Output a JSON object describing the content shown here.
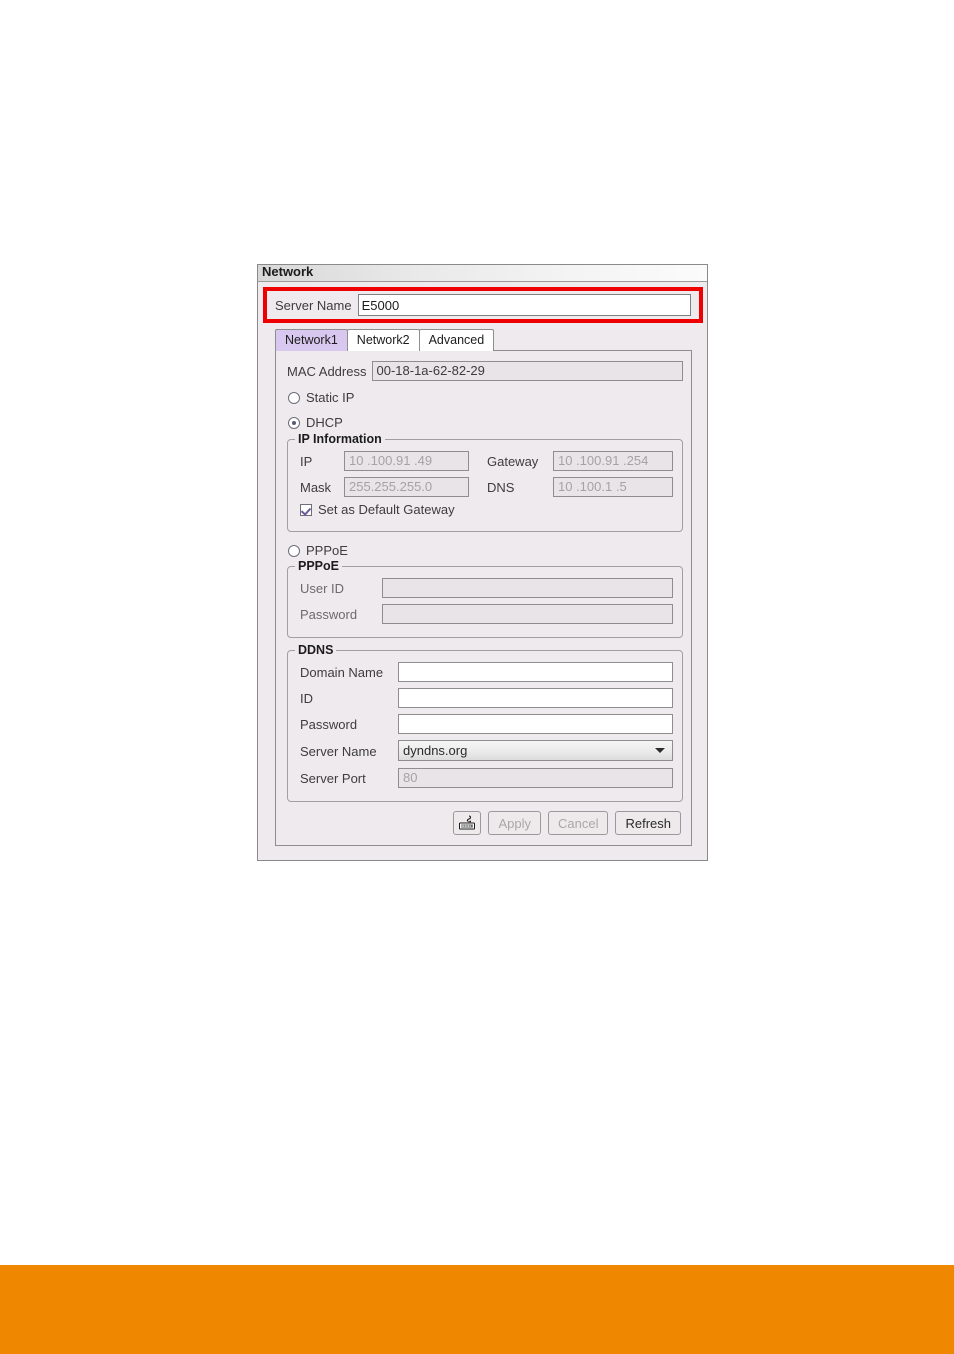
{
  "colors": {
    "footer_band": "#ef8700",
    "annotation_highlight": "#ee0000",
    "active_tab": "#d8c7ee",
    "panel_bg": "#efeaee"
  },
  "panel": {
    "title": "Network"
  },
  "server_name_row": {
    "label": "Server Name",
    "value": "E5000",
    "placeholder": ""
  },
  "tabs": [
    {
      "label": "Network1",
      "active": true
    },
    {
      "label": "Network2",
      "active": false
    },
    {
      "label": "Advanced",
      "active": false
    }
  ],
  "network1": {
    "mac": {
      "label": "MAC Address",
      "value": "00-18-1a-62-82-29"
    },
    "ip_mode": {
      "static_label": "Static IP",
      "static_selected": false,
      "dhcp_label": "DHCP",
      "dhcp_selected": true,
      "pppoe_label": "PPPoE",
      "pppoe_selected": false
    },
    "ip_information": {
      "legend": "IP Information",
      "ip_label": "IP",
      "ip_value": "10 .100.91 .49",
      "gateway_label": "Gateway",
      "gateway_value": "10 .100.91 .254",
      "mask_label": "Mask",
      "mask_value": "255.255.255.0",
      "dns_label": "DNS",
      "dns_value": "10 .100.1 .5",
      "default_gateway_label": "Set as Default Gateway",
      "default_gateway_checked": true
    },
    "pppoe": {
      "legend": "PPPoE",
      "user_id_label": "User ID",
      "user_id_value": "",
      "password_label": "Password",
      "password_value": ""
    },
    "ddns": {
      "legend": "DDNS",
      "domain_name_label": "Domain Name",
      "domain_name_value": "",
      "id_label": "ID",
      "id_value": "",
      "password_label": "Password",
      "password_value": "",
      "server_name_label": "Server Name",
      "server_name_value": "dyndns.org",
      "server_port_label": "Server Port",
      "server_port_value": "80"
    },
    "buttons": {
      "keyboard_icon": "virtual-keyboard-icon",
      "apply_label": "Apply",
      "apply_enabled": false,
      "cancel_label": "Cancel",
      "cancel_enabled": false,
      "refresh_label": "Refresh",
      "refresh_enabled": true
    }
  }
}
